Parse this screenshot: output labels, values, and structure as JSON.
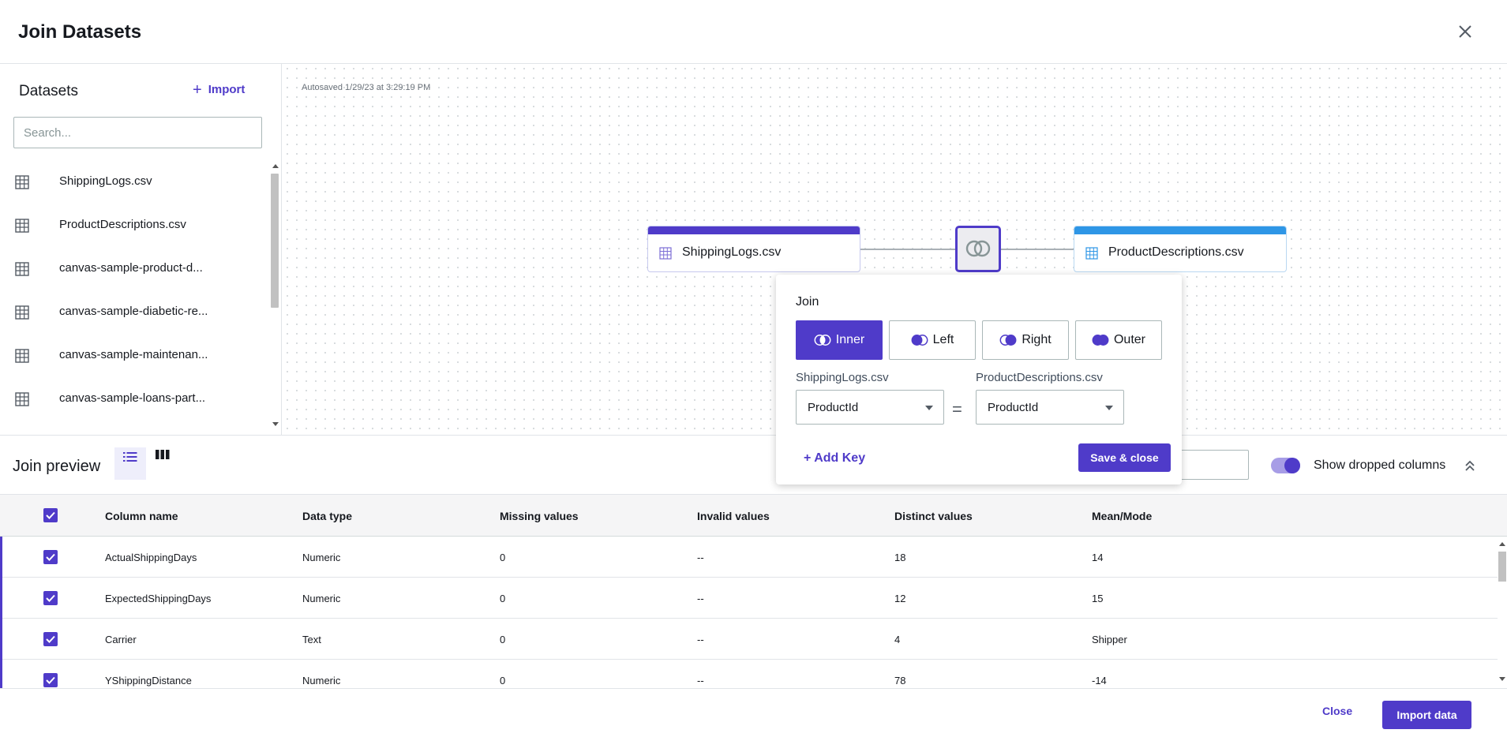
{
  "header": {
    "title": "Join Datasets"
  },
  "sidebar": {
    "title": "Datasets",
    "import_label": "Import",
    "search_placeholder": "Search...",
    "items": [
      {
        "label": "ShippingLogs.csv"
      },
      {
        "label": "ProductDescriptions.csv"
      },
      {
        "label": "canvas-sample-product-d..."
      },
      {
        "label": "canvas-sample-diabetic-re..."
      },
      {
        "label": "canvas-sample-maintenan..."
      },
      {
        "label": "canvas-sample-loans-part..."
      }
    ]
  },
  "canvas": {
    "autosave": "Autosaved 1/29/23 at 3:29:19 PM",
    "left_node": "ShippingLogs.csv",
    "right_node": "ProductDescriptions.csv"
  },
  "join_popover": {
    "title": "Join",
    "types": [
      {
        "label": "Inner",
        "active": true
      },
      {
        "label": "Left",
        "active": false
      },
      {
        "label": "Right",
        "active": false
      },
      {
        "label": "Outer",
        "active": false
      }
    ],
    "left_dataset": "ShippingLogs.csv",
    "left_key": "ProductId",
    "equals": "=",
    "right_dataset": "ProductDescriptions.csv",
    "right_key": "ProductId",
    "add_key_label": "+ Add Key",
    "save_label": "Save & close"
  },
  "preview": {
    "title": "Join preview",
    "show_dropped_label": "Show dropped columns",
    "show_dropped_on": true,
    "columns": [
      "Column name",
      "Data type",
      "Missing values",
      "Invalid values",
      "Distinct values",
      "Mean/Mode"
    ],
    "rows": [
      [
        "ActualShippingDays",
        "Numeric",
        "0",
        "--",
        "18",
        "14"
      ],
      [
        "ExpectedShippingDays",
        "Numeric",
        "0",
        "--",
        "12",
        "15"
      ],
      [
        "Carrier",
        "Text",
        "0",
        "--",
        "4",
        "Shipper"
      ],
      [
        "YShippingDistance",
        "Numeric",
        "0",
        "--",
        "78",
        "-14"
      ]
    ]
  },
  "footer": {
    "close_label": "Close",
    "import_label": "Import data"
  },
  "colors": {
    "accent": "#4f3bc9",
    "right_node": "#2e96e6"
  }
}
